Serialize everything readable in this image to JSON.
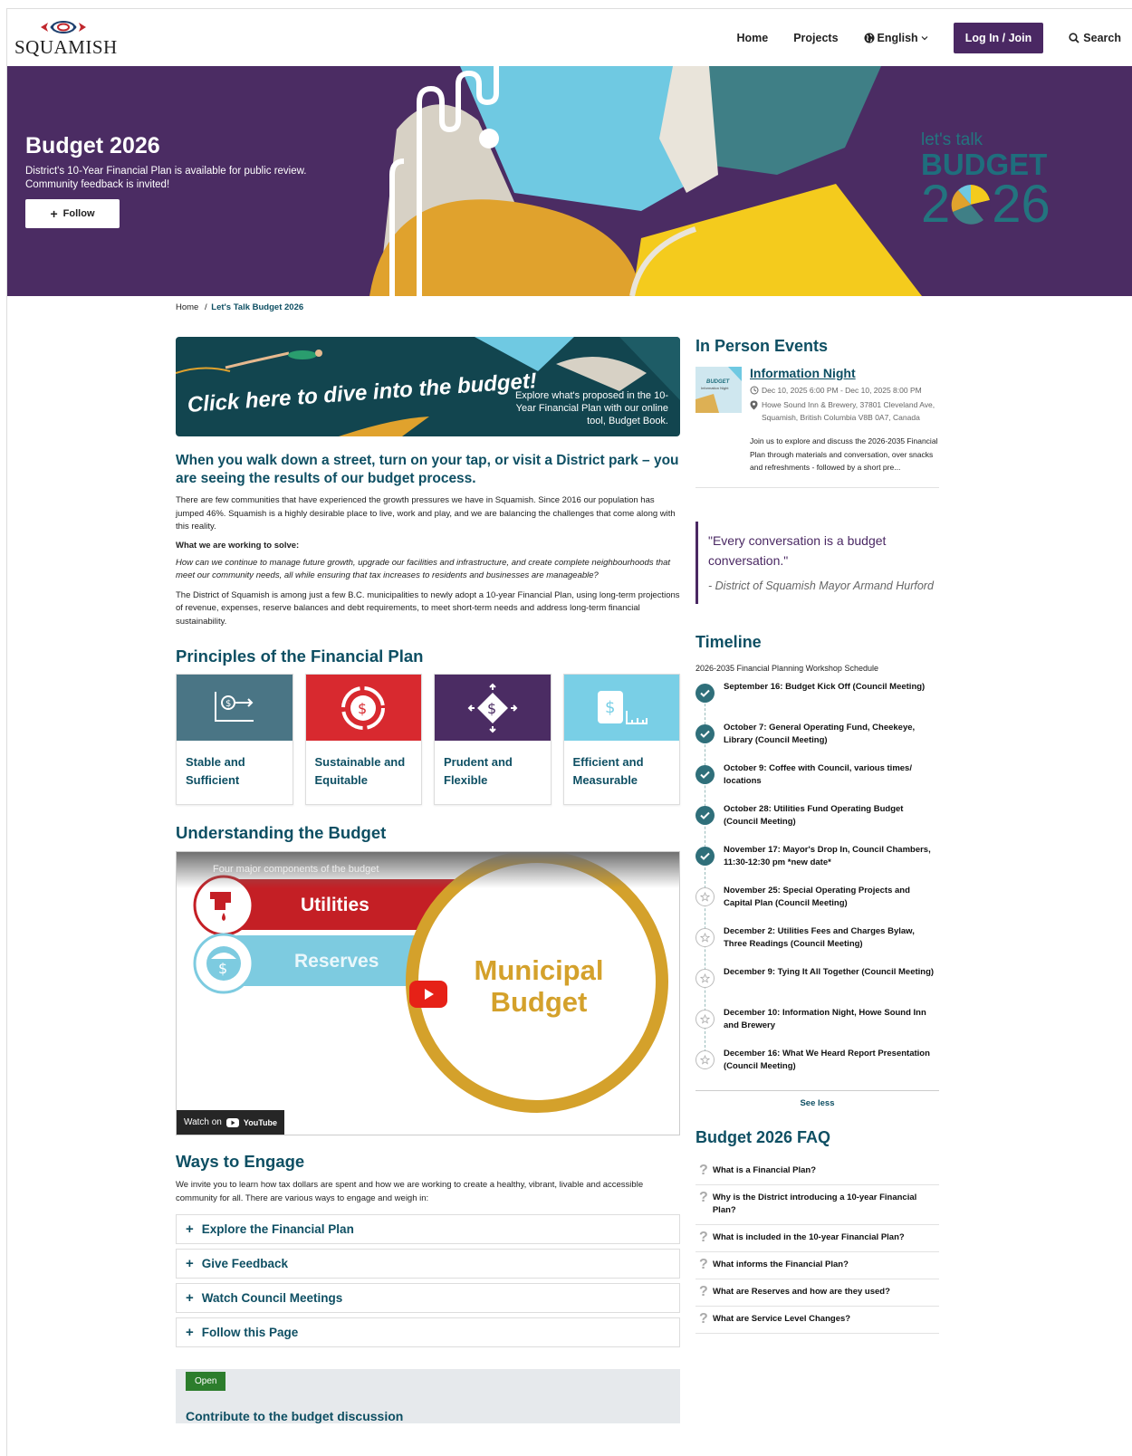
{
  "header": {
    "logo_text": "SQUAMISH",
    "nav": {
      "home": "Home",
      "projects": "Projects",
      "language": "English",
      "login": "Log In / Join",
      "search": "Search"
    }
  },
  "hero": {
    "title": "Budget 2026",
    "subtitle_line1": "District's 10-Year Financial Plan is available for public review.",
    "subtitle_line2": "Community feedback is invited!",
    "follow": "Follow",
    "logo_lets_talk": "let's talk",
    "logo_budget": "BUDGET",
    "logo_year_a": "2",
    "logo_year_b": "26"
  },
  "breadcrumb": {
    "home": "Home",
    "separator": "/",
    "current": "Let's Talk Budget 2026"
  },
  "banner": {
    "cta": "Click here to dive into the budget!",
    "side_text": "Explore what's proposed in the 10-Year Financial Plan with our online tool, Budget Book."
  },
  "intro": {
    "heading": "When you walk down a street, turn on your tap, or visit a District park – you are seeing the results of our budget process.",
    "p1": "There are few communities that have experienced the growth pressures we have in Squamish. Since 2016 our population has jumped 46%. Squamish is a highly desirable place to live, work and play, and we are balancing the challenges that come along with this reality.",
    "solve_label": "What we are working to solve:",
    "p_question": "How can we continue to manage future growth, upgrade our facilities and infrastructure, and create complete neighbourhoods that meet our community needs, all while ensuring that tax increases to residents and businesses are manageable?",
    "p2": "The District of Squamish is among just a few B.C. municipalities to newly adopt a 10-year Financial Plan, using long-term projections of revenue, expenses, reserve balances and debt requirements, to meet short-term needs and address long-term financial sustainability."
  },
  "principles": {
    "heading": "Principles of the Financial Plan",
    "items": [
      {
        "label": "Stable and Sufficient",
        "color": "#4a7585",
        "icon": "chart-dollar-icon"
      },
      {
        "label": "Sustainable and Equitable",
        "color": "#d8292f",
        "icon": "dollar-cycle-icon"
      },
      {
        "label": "Prudent and Flexible",
        "color": "#4b2c63",
        "icon": "dollar-arrows-icon"
      },
      {
        "label": "Efficient and Measurable",
        "color": "#79cfe6",
        "icon": "dollar-measure-icon"
      }
    ]
  },
  "video": {
    "heading": "Understanding the Budget",
    "title": "Four major components of the budget",
    "label_utilities": "Utilities",
    "label_reserves": "Reserves",
    "label_municipal": "Municipal",
    "label_budget": "Budget",
    "watch_on": "Watch on",
    "youtube": "YouTube"
  },
  "engage": {
    "heading": "Ways to Engage",
    "intro": "We invite you to learn how tax dollars are spent and how we are working to create a healthy, vibrant, livable and accessible community for all. There are various ways to engage and weigh in:",
    "items": [
      "Explore the Financial Plan",
      "Give Feedback",
      "Watch Council Meetings",
      "Follow this Page"
    ],
    "open_badge": "Open",
    "open_title": "Contribute to the budget discussion"
  },
  "events": {
    "heading": "In Person Events",
    "title": "Information Night",
    "thumb_line1": "BUDGET",
    "thumb_line2": "Information Night",
    "date": "Dec 10, 2025 6:00 PM - Dec 10, 2025 8:00 PM",
    "location": "Howe Sound Inn & Brewery, 37801 Cleveland Ave, Squamish, British Columbia V8B 0A7, Canada",
    "description": "Join us to explore and discuss the 2026-2035 Financial Plan through materials and conversation, over snacks and refreshments - followed by a short pre..."
  },
  "quote": {
    "text": "\"Every conversation is a budget conversation.\"",
    "author": "- District of Squamish Mayor Armand Hurford"
  },
  "timeline": {
    "heading": "Timeline",
    "subtitle": "2026-2035 Financial Planning Workshop Schedule",
    "items": [
      {
        "text": "September 16: Budget Kick Off (Council Meeting)",
        "status": "done"
      },
      {
        "text": "October 7: General Operating Fund, Cheekeye, Library (Council Meeting)",
        "status": "done"
      },
      {
        "text": "October 9: Coffee with Council, various times/ locations",
        "status": "done"
      },
      {
        "text": "October 28: Utilities Fund Operating Budget (Council Meeting)",
        "status": "done"
      },
      {
        "text": "November 17: Mayor's Drop In, Council Chambers, 11:30-12:30 pm *new date*",
        "status": "done"
      },
      {
        "text": "November 25: Special Operating Projects and Capital Plan (Council Meeting)",
        "status": "upcoming"
      },
      {
        "text": "December 2: Utilities Fees and Charges Bylaw, Three Readings (Council Meeting)",
        "status": "upcoming"
      },
      {
        "text": "December 9: Tying It All Together (Council Meeting)",
        "status": "upcoming"
      },
      {
        "text": "December 10: Information Night, Howe Sound Inn and Brewery",
        "status": "upcoming"
      },
      {
        "text": "December 16: What We Heard Report Presentation (Council Meeting)",
        "status": "upcoming"
      }
    ],
    "see_less": "See less"
  },
  "faq": {
    "heading": "Budget 2026 FAQ",
    "items": [
      "What is a Financial Plan?",
      "Why is the District introducing a 10-year Financial Plan?",
      "What is included in the 10-year Financial Plan?",
      "What informs the Financial Plan?",
      "What are Reserves and how are they used?",
      "What are Service Level Changes?"
    ]
  }
}
